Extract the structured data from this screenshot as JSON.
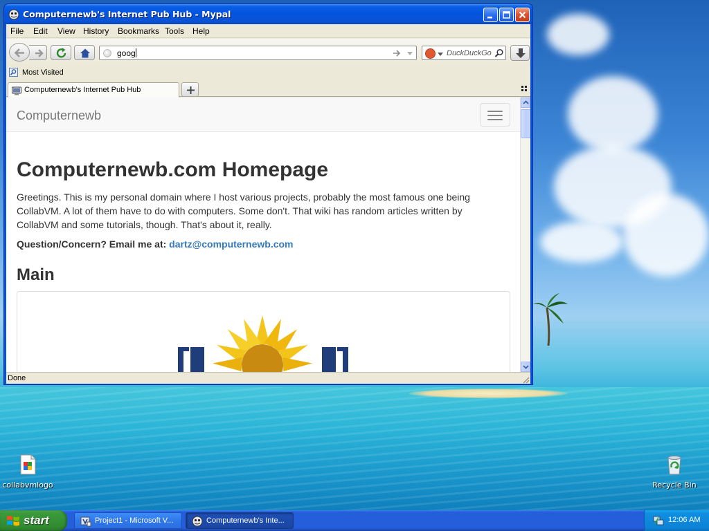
{
  "desktop": {
    "icons": [
      {
        "label": "collabvmlogo"
      },
      {
        "label": "Recycle Bin"
      }
    ]
  },
  "window": {
    "title": "Computernewb's Internet Pub Hub - Mypal",
    "menu": [
      "File",
      "Edit",
      "View",
      "History",
      "Bookmarks",
      "Tools",
      "Help"
    ],
    "url_value": "goog",
    "search_placeholder": "DuckDuckGo",
    "bookmarks": [
      {
        "label": "Most Visited"
      }
    ],
    "tab": {
      "label": "Computernewb's Internet Pub Hub"
    },
    "status": "Done"
  },
  "page": {
    "brand": "Computernewb",
    "heading": "Computernewb.com Homepage",
    "intro": "Greetings. This is my personal domain where I host various projects, probably the most famous one being CollabVM. A lot of them have to do with computers. Some don't. That wiki has random articles written by CollabVM and some tutorials, though. That's about it, really.",
    "contact_label": "Question/Concern? Email me at:",
    "contact_email": "dartz@computernewb.com",
    "section_title": "Main"
  },
  "taskbar": {
    "start_label": "start",
    "tasks": [
      {
        "label": "Project1 - Microsoft V...",
        "active": false
      },
      {
        "label": "Computernewb's Inte...",
        "active": true
      }
    ],
    "clock": "12:06 AM"
  },
  "colors": {
    "title_blue": "#0454df",
    "link_blue": "#337ab7",
    "start_green": "#318a31"
  }
}
